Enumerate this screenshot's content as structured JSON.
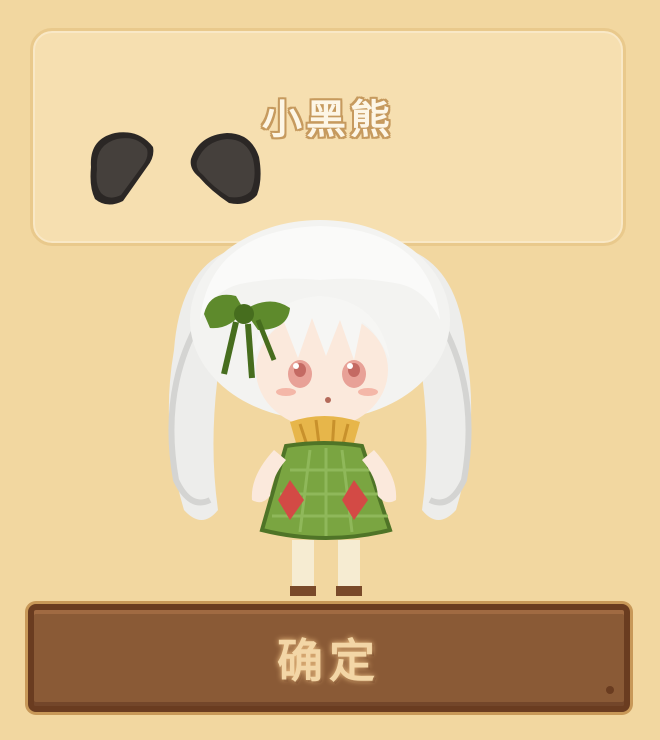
{
  "item": {
    "name": "小黑熊",
    "icon": "bear-ears-icon"
  },
  "character": {
    "sprite": "character-sprite"
  },
  "confirm": {
    "label": "确定"
  },
  "colors": {
    "background": "#f0d49b",
    "panel": "#f6dfb0",
    "button": "#8a5a36",
    "button_text": "#f3d6a6",
    "ears": "#3f3a36"
  }
}
